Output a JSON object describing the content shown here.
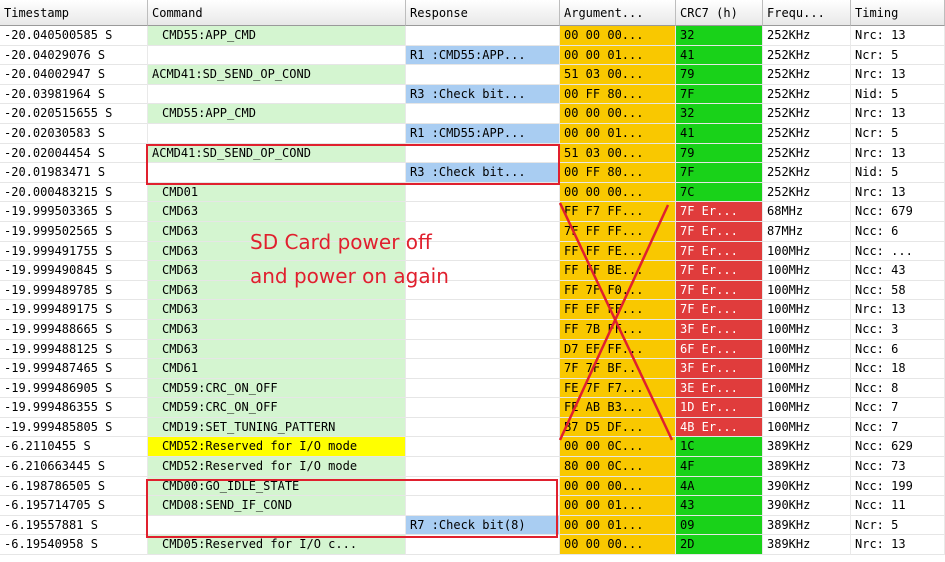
{
  "columns": [
    "Timestamp",
    "Command",
    "Response",
    "Argument...",
    "CRC7 (h)",
    "Frequ...",
    "Timing"
  ],
  "rows": [
    {
      "ts": "-20.040500585 S",
      "cmd": "CMD55:APP_CMD",
      "resp": "",
      "arg": "00 00 00...",
      "crc": "32",
      "freq": "252KHz",
      "timing": "Nrc: 13",
      "indent": true,
      "crc_err": false,
      "cmd_hl": false
    },
    {
      "ts": "-20.04029076 S",
      "cmd": "",
      "resp": "R1 :CMD55:APP...",
      "arg": "00 00 01...",
      "crc": "41",
      "freq": "252KHz",
      "timing": "Ncr: 5",
      "indent": false,
      "crc_err": false,
      "cmd_hl": false
    },
    {
      "ts": "-20.04002947 S",
      "cmd": "ACMD41:SD_SEND_OP_COND",
      "resp": "",
      "arg": "51 03 00...",
      "crc": "79",
      "freq": "252KHz",
      "timing": "Nrc: 13",
      "indent": false,
      "crc_err": false,
      "cmd_hl": false
    },
    {
      "ts": "-20.03981964 S",
      "cmd": "",
      "resp": "R3 :Check bit...",
      "arg": "00 FF 80...",
      "crc": "7F",
      "freq": "252KHz",
      "timing": "Nid: 5",
      "indent": false,
      "crc_err": false,
      "cmd_hl": false
    },
    {
      "ts": "-20.020515655 S",
      "cmd": "CMD55:APP_CMD",
      "resp": "",
      "arg": "00 00 00...",
      "crc": "32",
      "freq": "252KHz",
      "timing": "Nrc: 13",
      "indent": true,
      "crc_err": false,
      "cmd_hl": false
    },
    {
      "ts": "-20.02030583 S",
      "cmd": "",
      "resp": "R1 :CMD55:APP...",
      "arg": "00 00 01...",
      "crc": "41",
      "freq": "252KHz",
      "timing": "Ncr: 5",
      "indent": false,
      "crc_err": false,
      "cmd_hl": false
    },
    {
      "ts": "-20.02004454 S",
      "cmd": "ACMD41:SD_SEND_OP_COND",
      "resp": "",
      "arg": "51 03 00...",
      "crc": "79",
      "freq": "252KHz",
      "timing": "Nrc: 13",
      "indent": false,
      "crc_err": false,
      "cmd_hl": false
    },
    {
      "ts": "-20.01983471 S",
      "cmd": "",
      "resp": "R3 :Check bit...",
      "arg": "00 FF 80...",
      "crc": "7F",
      "freq": "252KHz",
      "timing": "Nid: 5",
      "indent": false,
      "crc_err": false,
      "cmd_hl": false
    },
    {
      "ts": "-20.000483215 S",
      "cmd": "CMD01",
      "resp": "",
      "arg": "00 00 00...",
      "crc": "7C",
      "freq": "252KHz",
      "timing": "Nrc: 13",
      "indent": true,
      "crc_err": false,
      "cmd_hl": false
    },
    {
      "ts": "-19.999503365 S",
      "cmd": "CMD63",
      "resp": "",
      "arg": "FF F7 FF...",
      "crc": "7F Er...",
      "freq": "68MHz",
      "timing": "Ncc: 679",
      "indent": true,
      "crc_err": true,
      "cmd_hl": false
    },
    {
      "ts": "-19.999502565 S",
      "cmd": "CMD63",
      "resp": "",
      "arg": "7F FF FF...",
      "crc": "7F Er...",
      "freq": "87MHz",
      "timing": "Ncc: 6",
      "indent": true,
      "crc_err": true,
      "cmd_hl": false
    },
    {
      "ts": "-19.999491755 S",
      "cmd": "CMD63",
      "resp": "",
      "arg": "FF FF FE...",
      "crc": "7F Er...",
      "freq": "100MHz",
      "timing": "Ncc: ...",
      "indent": true,
      "crc_err": true,
      "cmd_hl": false
    },
    {
      "ts": "-19.999490845 S",
      "cmd": "CMD63",
      "resp": "",
      "arg": "FF FF BE...",
      "crc": "7F Er...",
      "freq": "100MHz",
      "timing": "Ncc: 43",
      "indent": true,
      "crc_err": true,
      "cmd_hl": false
    },
    {
      "ts": "-19.999489785 S",
      "cmd": "CMD63",
      "resp": "",
      "arg": "FF 7F F0...",
      "crc": "7F Er...",
      "freq": "100MHz",
      "timing": "Ncc: 58",
      "indent": true,
      "crc_err": true,
      "cmd_hl": false
    },
    {
      "ts": "-19.999489175 S",
      "cmd": "CMD63",
      "resp": "",
      "arg": "FF EF FF...",
      "crc": "7F Er...",
      "freq": "100MHz",
      "timing": "Nrc: 13",
      "indent": true,
      "crc_err": true,
      "cmd_hl": false
    },
    {
      "ts": "-19.999488665 S",
      "cmd": "CMD63",
      "resp": "",
      "arg": "FF 7B FF...",
      "crc": "3F Er...",
      "freq": "100MHz",
      "timing": "Ncc: 3",
      "indent": true,
      "crc_err": true,
      "cmd_hl": false
    },
    {
      "ts": "-19.999488125 S",
      "cmd": "CMD63",
      "resp": "",
      "arg": "D7 EF FF...",
      "crc": "6F Er...",
      "freq": "100MHz",
      "timing": "Ncc: 6",
      "indent": true,
      "crc_err": true,
      "cmd_hl": false
    },
    {
      "ts": "-19.999487465 S",
      "cmd": "CMD61",
      "resp": "",
      "arg": "7F 7F BF...",
      "crc": "3F Er...",
      "freq": "100MHz",
      "timing": "Ncc: 18",
      "indent": true,
      "crc_err": true,
      "cmd_hl": false
    },
    {
      "ts": "-19.999486905 S",
      "cmd": "CMD59:CRC_ON_OFF",
      "resp": "",
      "arg": "FE 7F F7...",
      "crc": "3E Er...",
      "freq": "100MHz",
      "timing": "Ncc: 8",
      "indent": true,
      "crc_err": true,
      "cmd_hl": false
    },
    {
      "ts": "-19.999486355 S",
      "cmd": "CMD59:CRC_ON_OFF",
      "resp": "",
      "arg": "FE AB B3...",
      "crc": "1D Er...",
      "freq": "100MHz",
      "timing": "Ncc: 7",
      "indent": true,
      "crc_err": true,
      "cmd_hl": false
    },
    {
      "ts": "-19.999485805 S",
      "cmd": "CMD19:SET_TUNING_PATTERN",
      "resp": "",
      "arg": "B7 D5 DF...",
      "crc": "4B Er...",
      "freq": "100MHz",
      "timing": "Ncc: 7",
      "indent": true,
      "crc_err": true,
      "cmd_hl": false
    },
    {
      "ts": "-6.2110455 S",
      "cmd": "CMD52:Reserved for I/O mode",
      "resp": "",
      "arg": "00 00 0C...",
      "crc": "1C",
      "freq": "389KHz",
      "timing": "Ncc: 629",
      "indent": true,
      "crc_err": false,
      "cmd_hl": true
    },
    {
      "ts": "-6.210663445 S",
      "cmd": "CMD52:Reserved for I/O mode",
      "resp": "",
      "arg": "80 00 0C...",
      "crc": "4F",
      "freq": "389KHz",
      "timing": "Ncc: 73",
      "indent": true,
      "crc_err": false,
      "cmd_hl": false
    },
    {
      "ts": "-6.198786505 S",
      "cmd": "CMD00:GO_IDLE_STATE",
      "resp": "",
      "arg": "00 00 00...",
      "crc": "4A",
      "freq": "390KHz",
      "timing": "Ncc: 199",
      "indent": true,
      "crc_err": false,
      "cmd_hl": false
    },
    {
      "ts": "-6.195714705 S",
      "cmd": "CMD08:SEND_IF_COND",
      "resp": "",
      "arg": "00 00 01...",
      "crc": "43",
      "freq": "390KHz",
      "timing": "Ncc: 11",
      "indent": true,
      "crc_err": false,
      "cmd_hl": false
    },
    {
      "ts": "-6.19557881 S",
      "cmd": "",
      "resp": "R7 :Check bit(8)",
      "arg": "00 00 01...",
      "crc": "09",
      "freq": "389KHz",
      "timing": "Ncr: 5",
      "indent": false,
      "crc_err": false,
      "cmd_hl": false
    },
    {
      "ts": "-6.19540958 S",
      "cmd": "CMD05:Reserved for I/O c...",
      "resp": "",
      "arg": "00 00 00...",
      "crc": "2D",
      "freq": "389KHz",
      "timing": "Nrc: 13",
      "indent": true,
      "crc_err": false,
      "cmd_hl": false
    }
  ],
  "annotation": {
    "line1": "SD Card power off",
    "line2": "and power on again",
    "color": "#e0202e"
  }
}
